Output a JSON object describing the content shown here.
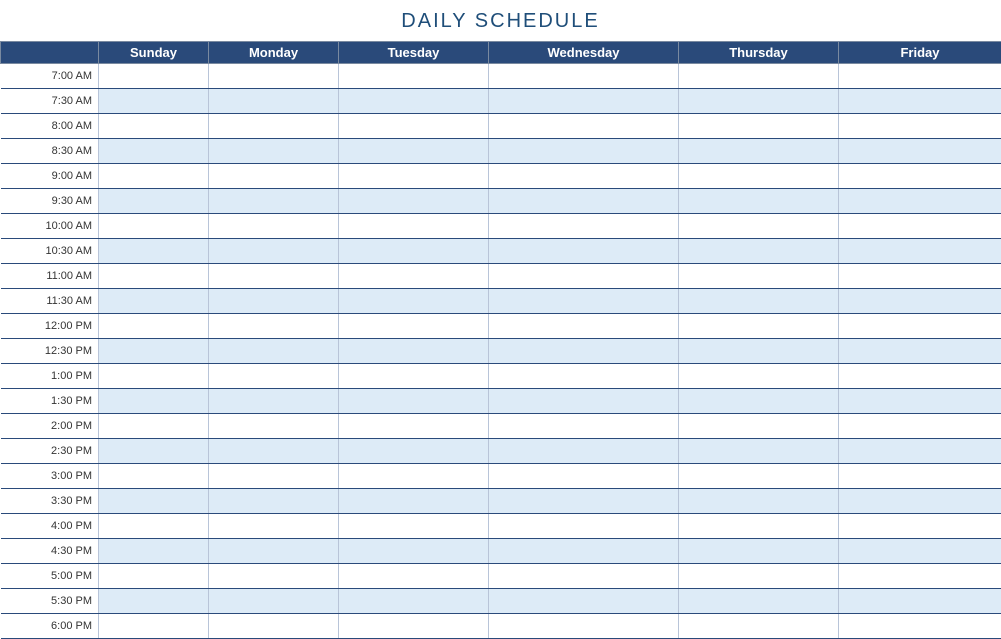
{
  "title": "DAILY SCHEDULE",
  "days": [
    "Sunday",
    "Monday",
    "Tuesday",
    "Wednesday",
    "Thursday",
    "Friday"
  ],
  "times": [
    "7:00 AM",
    "7:30 AM",
    "8:00 AM",
    "8:30 AM",
    "9:00 AM",
    "9:30 AM",
    "10:00 AM",
    "10:30 AM",
    "11:00 AM",
    "11:30 AM",
    "12:00 PM",
    "12:30 PM",
    "1:00 PM",
    "1:30 PM",
    "2:00 PM",
    "2:30 PM",
    "3:00 PM",
    "3:30 PM",
    "4:00 PM",
    "4:30 PM",
    "5:00 PM",
    "5:30 PM",
    "6:00 PM"
  ],
  "colors": {
    "header_bg": "#2a4a7a",
    "alt_row_bg": "#ddebf7",
    "title_color": "#1f4e79"
  }
}
